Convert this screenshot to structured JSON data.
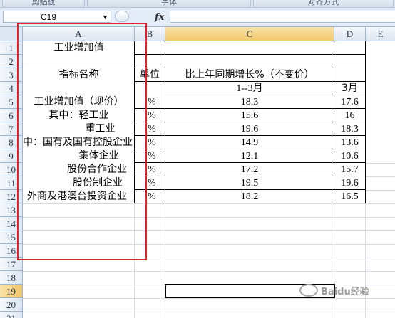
{
  "ribbon": {
    "groups": [
      "剪贴板",
      "字体",
      "对齐方式"
    ]
  },
  "formula_bar": {
    "name_box": "C19",
    "fx_label": "fx",
    "formula": ""
  },
  "columns": [
    "A",
    "B",
    "C",
    "D",
    "E"
  ],
  "rows": [
    "1",
    "2",
    "3",
    "4",
    "5",
    "6",
    "7",
    "8",
    "9",
    "10",
    "11",
    "12",
    "13",
    "14",
    "15",
    "16",
    "17",
    "18",
    "19",
    "20",
    "21"
  ],
  "cells": {
    "r1": {
      "a": "工业增加值"
    },
    "r3": {
      "a": "指标名称",
      "b": "单位",
      "c": "比上年同期增长%（不变价）"
    },
    "r4": {
      "c": "1--3月",
      "d": "3月"
    },
    "r5": {
      "a": "工业增加值（现价）",
      "b": "%",
      "c": "18.3",
      "d": "17.6"
    },
    "r6": {
      "a": "其中：轻工业",
      "b": "%",
      "c": "15.6",
      "d": "16"
    },
    "r7": {
      "a": "重工业",
      "b": "%",
      "c": "19.6",
      "d": "18.3"
    },
    "r8": {
      "a": "其中：国有及国有控股企业",
      "b": "%",
      "c": "14.9",
      "d": "13.6"
    },
    "r9": {
      "a": "集体企业",
      "b": "%",
      "c": "12.1",
      "d": "10.6"
    },
    "r10": {
      "a": "股份合作企业",
      "b": "%",
      "c": "17.2",
      "d": "15.7"
    },
    "r11": {
      "a": "股份制企业",
      "b": "%",
      "c": "19.5",
      "d": "19.6"
    },
    "r12": {
      "a": "外商及港澳台投资企业",
      "b": "%",
      "c": "18.2",
      "d": "16.5"
    }
  },
  "watermark": "Baidu经验",
  "colors": {
    "highlight_box": "#e0202a",
    "selected_header": "#f2c86a"
  }
}
